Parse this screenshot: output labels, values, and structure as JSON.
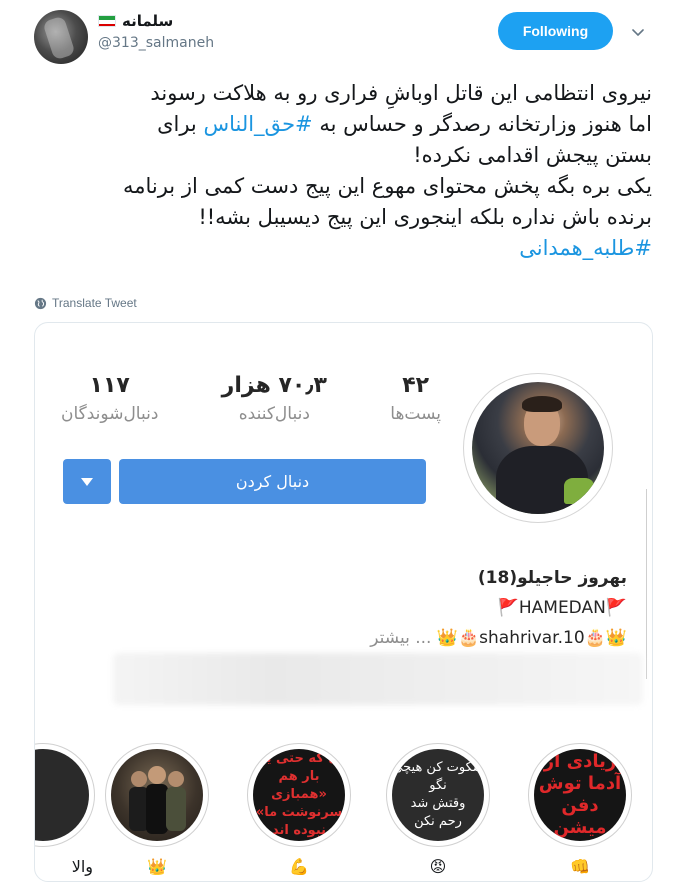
{
  "tweet": {
    "author_name": "سلمانه",
    "handle": "@313_salmaneh",
    "follow_label": "Following",
    "lines": [
      [
        "نیروی انتظامی این قاتل اوباشِ فراری رو به هلاکت رسوند"
      ],
      [
        "اما هنوز وزارتخانه رصدگر و حساس به ",
        "#حق_الناس",
        " برای"
      ],
      [
        "بستن پیجش اقدامی نکرده!"
      ],
      [
        "یکی بره بگه پخش محتوای مهوع این پیج دست کمی از برنامه"
      ],
      [
        "برنده باش نداره بلکه اینجوری این پیج دیسیبل بشه!!"
      ],
      [
        "#طلبه_همدانی"
      ]
    ],
    "translate_label": "Translate Tweet"
  },
  "embedded_profile": {
    "stats": [
      {
        "value": "۴۲",
        "label": "پست‌ها"
      },
      {
        "value": "۷۰٫۳ هزار",
        "label": "دنبال‌کننده"
      },
      {
        "value": "۱۱۷",
        "label": "دنبال‌شوندگان"
      }
    ],
    "follow_button_label": "دنبال کردن",
    "bio_name": "بهروز حاجیلو(18)",
    "bio_location": "🚩HAMEDAN🚩",
    "bio_line3": "👑🎂shahrivar.10🎂👑",
    "bio_more": "... بیشتر",
    "highlights": [
      {
        "label": "والا",
        "text": ""
      },
      {
        "label": "👑",
        "text": ""
      },
      {
        "label": "💪",
        "text": "ای‌ که حتی یک بار هم\n«همبازی سرنوشت ما»\nنبوده اند"
      },
      {
        "label": "😡",
        "text": "سکوت کن هیچی نگو\nوقتش شد\nرحم نکن"
      },
      {
        "label": "👊",
        "text": "زیادی از آدما توش دفن\nمیشن"
      }
    ]
  },
  "colors": {
    "twitter_blue": "#1da1f2",
    "hashtag_blue": "#1b95e0",
    "ig_blue": "#4a90e2"
  }
}
